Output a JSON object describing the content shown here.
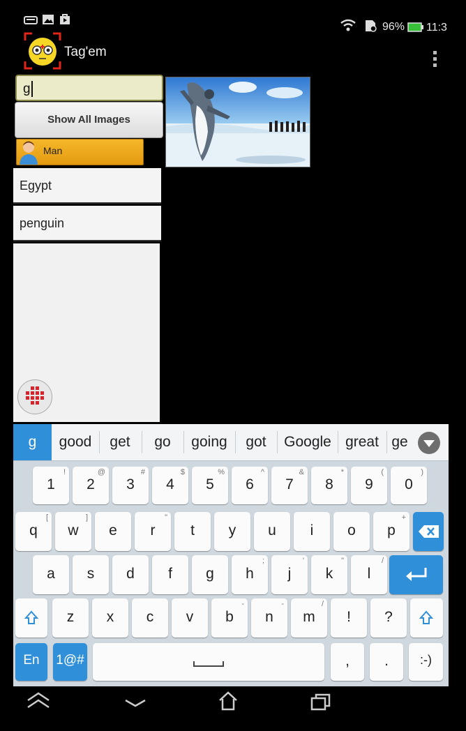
{
  "status_bar": {
    "battery": "96%",
    "time": "11:3"
  },
  "app_bar": {
    "title": "Tag'em",
    "logo_icon": "owl-face-logo",
    "overflow_icon": "more-vert-icon"
  },
  "sidebar": {
    "search": {
      "value": "g"
    },
    "show_all_label": "Show All Images",
    "selected_tag": {
      "label": "Man",
      "icon": "person-icon"
    },
    "tags": [
      "Egypt",
      "penguin"
    ],
    "fab_icon": "grid-icon"
  },
  "image": {
    "subject": "penguin-photo"
  },
  "keyboard": {
    "suggestions": [
      "g",
      "good",
      "get",
      "go",
      "going",
      "got",
      "Google",
      "great",
      "ge"
    ],
    "expand_icon": "chevron-down-icon",
    "number_row": [
      {
        "k": "1",
        "s": "!"
      },
      {
        "k": "2",
        "s": "@"
      },
      {
        "k": "3",
        "s": "#"
      },
      {
        "k": "4",
        "s": "$"
      },
      {
        "k": "5",
        "s": "%"
      },
      {
        "k": "6",
        "s": "^"
      },
      {
        "k": "7",
        "s": "&"
      },
      {
        "k": "8",
        "s": "*"
      },
      {
        "k": "9",
        "s": "("
      },
      {
        "k": "0",
        "s": ")"
      }
    ],
    "row_q": [
      {
        "k": "q",
        "s": "["
      },
      {
        "k": "w",
        "s": "]"
      },
      {
        "k": "e",
        "s": ""
      },
      {
        "k": "r",
        "s": "\""
      },
      {
        "k": "t",
        "s": ""
      },
      {
        "k": "y",
        "s": ""
      },
      {
        "k": "u",
        "s": ""
      },
      {
        "k": "i",
        "s": ""
      },
      {
        "k": "o",
        "s": ""
      },
      {
        "k": "p",
        "s": "+"
      }
    ],
    "row_a": [
      {
        "k": "a",
        "s": ""
      },
      {
        "k": "s",
        "s": ""
      },
      {
        "k": "d",
        "s": ""
      },
      {
        "k": "f",
        "s": ""
      },
      {
        "k": "g",
        "s": ""
      },
      {
        "k": "h",
        "s": ";"
      },
      {
        "k": "j",
        "s": "'"
      },
      {
        "k": "k",
        "s": "\""
      },
      {
        "k": "l",
        "s": "/"
      }
    ],
    "row_z": [
      {
        "k": "z",
        "s": ""
      },
      {
        "k": "x",
        "s": ""
      },
      {
        "k": "c",
        "s": ""
      },
      {
        "k": "v",
        "s": ""
      },
      {
        "k": "b",
        "s": "-"
      },
      {
        "k": "n",
        "s": "-"
      },
      {
        "k": "m",
        "s": "/"
      },
      {
        "k": "!",
        "s": ""
      },
      {
        "k": "?",
        "s": ""
      }
    ],
    "lang_label": "En",
    "symbols_label": "1@#",
    "comma": ",",
    "period": ".",
    "smiley": ":-)"
  },
  "nav_bar": {
    "back_icon": "back-icon",
    "hide_keyboard_icon": "chevron-down-icon",
    "home_icon": "home-icon",
    "recents_icon": "recents-icon"
  }
}
